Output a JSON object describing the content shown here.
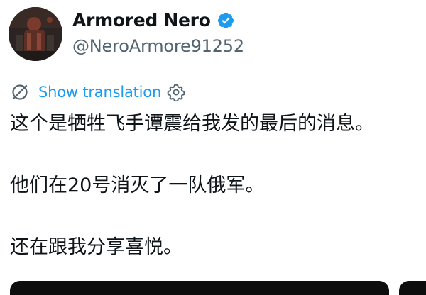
{
  "author": {
    "display_name": "Armored Nero",
    "handle": "@NeroArmore91252",
    "verified": true,
    "verified_color": "#1d9bf0"
  },
  "translate": {
    "label": "Show translation",
    "icon": "translate-globe-icon",
    "settings_icon": "gear-icon",
    "color": "#1d9bf0"
  },
  "tweet": {
    "lines": [
      "这个是牺牲飞手谭震给我发的最后的消息。",
      "他们在20号消灭了一队俄军。",
      "还在跟我分享喜悦。"
    ]
  },
  "colors": {
    "text": "#0f1419",
    "secondary": "#536471"
  }
}
